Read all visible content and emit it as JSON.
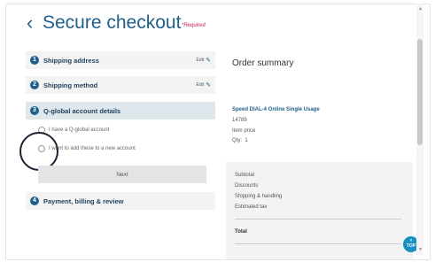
{
  "header": {
    "back_icon": "chevron-left-icon",
    "title": "Secure checkout",
    "required_note": "*Required"
  },
  "steps": [
    {
      "number": "1",
      "label": "Shipping address",
      "edit": "Edit"
    },
    {
      "number": "2",
      "label": "Shipping method",
      "edit": "Edit"
    },
    {
      "number": "3",
      "label": "Q-global account details"
    },
    {
      "number": "4",
      "label": "Payment, billing & review"
    }
  ],
  "account_options": [
    "I have a Q-global account",
    "I want to add these to a new account"
  ],
  "next_label": "Next",
  "summary": {
    "title": "Order summary",
    "product_name": "Speed DIAL-4 Online Single Usage",
    "product_code": "14789",
    "item_price_label": "Item price",
    "qty_label": "Qty:",
    "qty_value": "1",
    "totals": [
      "Subtotal",
      "Discounts",
      "Shipping & handling",
      "Estimated tax"
    ],
    "total_label": "Total"
  },
  "top_button": {
    "arrow": "^",
    "label": "TOP"
  },
  "colors": {
    "brand": "#1f5f8b",
    "accent": "#1a8fc2",
    "required": "#c2185b"
  }
}
